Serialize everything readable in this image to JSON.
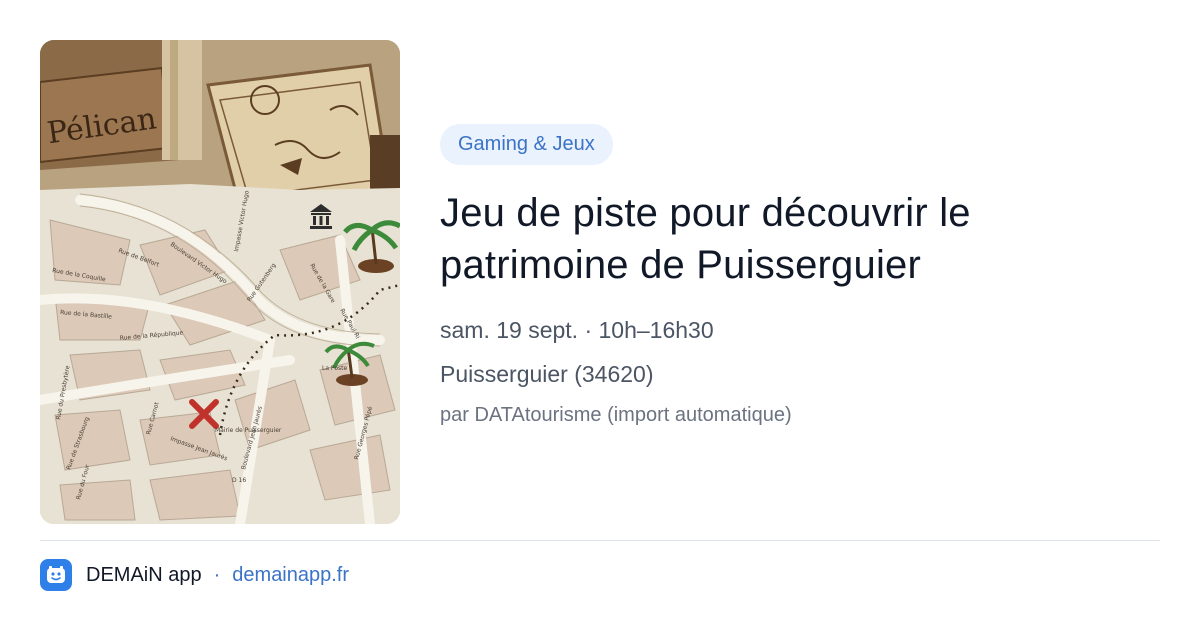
{
  "card": {
    "image": {
      "alt": "Map illustration",
      "sign_text": "Pélican",
      "streets": [
        "Rue de Belfort",
        "Boulevard Victor Hugo",
        "Rue de la Coquille",
        "Rue de la Bastille",
        "Rue de la République",
        "Rue Gutenberg",
        "Rue de la Gare",
        "Impasse Victor Hugo",
        "Rue Paul Ri",
        "Rue du Presbytère",
        "Rue Carnot",
        "Rue de Strasbourg",
        "Impasse Jean Jaurès",
        "Boulevard Jean Jaurès",
        "Rue du Four",
        "Rue Georges Pépé",
        "Mairie de Puisserguier",
        "La Poste",
        "D 16"
      ]
    },
    "tag": "Gaming & Jeux",
    "title": "Jeu de piste pour découvrir le patrimoine de Puisserguier",
    "datetime": "sam. 19 sept. · 10h–16h30",
    "location": "Puisserguier (34620)",
    "source": "par DATAtourisme (import automatique)"
  },
  "footer": {
    "app_name": "DEMAiN app",
    "separator": "·",
    "domain": "demainapp.fr"
  },
  "colors": {
    "accent": "#3b73c6",
    "tag_background": "#eaf2fd",
    "app_icon": "#2f7fe8"
  },
  "icons": {
    "app": "demain-app-icon",
    "museum": "museum-icon",
    "x_mark": "x-marker-icon",
    "palm": "palm-tree-icon"
  }
}
